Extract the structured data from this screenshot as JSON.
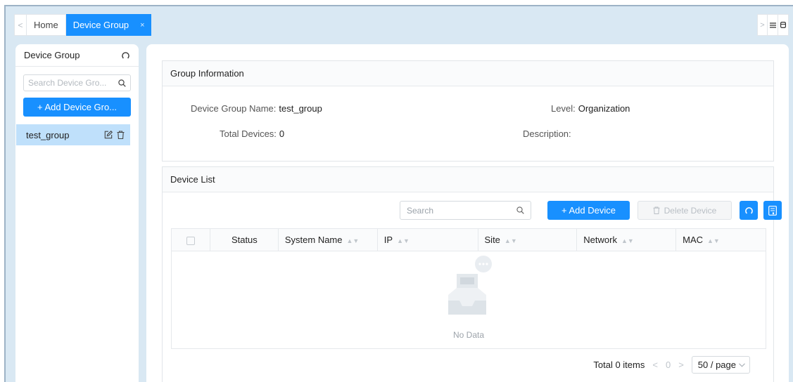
{
  "tabs": {
    "items": [
      {
        "label": "Home"
      },
      {
        "label": "Device Group",
        "close": "×"
      }
    ]
  },
  "sidebar": {
    "title": "Device Group",
    "search_placeholder": "Search Device Gro...",
    "add_label": "+ Add Device Gro...",
    "groups": [
      {
        "name": "test_group"
      }
    ]
  },
  "group_info": {
    "title": "Group Information",
    "name_label": "Device Group Name:",
    "name_value": "test_group",
    "level_label": "Level:",
    "level_value": "Organization",
    "total_label": "Total Devices:",
    "total_value": "0",
    "desc_label": "Description:",
    "desc_value": ""
  },
  "device_list": {
    "title": "Device List",
    "search_placeholder": "Search",
    "add_label": "+ Add Device",
    "delete_label": "Delete Device",
    "columns": [
      "Status",
      "System Name",
      "IP",
      "Site",
      "Network",
      "MAC"
    ],
    "empty_text": "No Data"
  },
  "pagination": {
    "total": "Total 0 items",
    "page": "0",
    "page_size": "50 / page"
  },
  "colors": {
    "accent": "#1890ff",
    "selected_row": "#bfe0fb",
    "frame_bg": "#d9e8f3"
  }
}
